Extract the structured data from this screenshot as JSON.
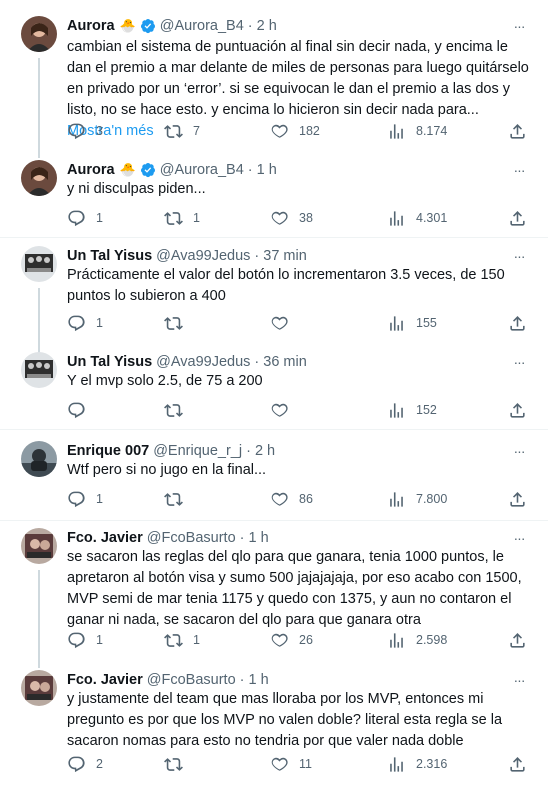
{
  "ui": {
    "more_label": "···",
    "show_more_label": "Mostra'n més"
  },
  "tweets": [
    {
      "name": "Aurora",
      "emoji": "🐣",
      "handle": "@Aurora_B4",
      "time": "2 h",
      "text": "cambian el sistema de puntuación al final sin decir nada, y encima le dan el premio a mar delante de miles de personas para luego quitárselo en privado por un ‘error’. si se equivocan le dan el premio a las dos y listo, no se hace esto. y encima lo hicieron sin decir nada para...",
      "replies": "3",
      "retweets": "7",
      "likes": "182",
      "views": "8.174"
    },
    {
      "name": "Aurora",
      "emoji": "🐣",
      "handle": "@Aurora_B4",
      "time": "1 h",
      "text": "y ni disculpas piden...",
      "replies": "1",
      "retweets": "1",
      "likes": "38",
      "views": "4.301"
    },
    {
      "name": "Un Tal Yisus",
      "handle": "@Ava99Jedus",
      "time": "37 min",
      "text": "Prácticamente el valor del botón lo incrementaron 3.5 veces, de 150 puntos lo subieron a 400",
      "replies": "1",
      "retweets": "",
      "likes": "",
      "views": "155"
    },
    {
      "name": "Un Tal Yisus",
      "handle": "@Ava99Jedus",
      "time": "36 min",
      "text": "Y el mvp solo 2.5, de 75 a 200",
      "replies": "",
      "retweets": "",
      "likes": "",
      "views": "152"
    },
    {
      "name": "Enrique 007",
      "handle": "@Enrique_r_j",
      "time": "2 h",
      "text": "Wtf pero si no jugo en la final...",
      "replies": "1",
      "retweets": "",
      "likes": "86",
      "views": "7.800"
    },
    {
      "name": "Fco. Javier",
      "handle": "@FcoBasurto",
      "time": "1 h",
      "text": "se sacaron las reglas del qlo para que ganara, tenia 1000 puntos, le apretaron al botón visa y sumo 500 jajajajaja, por eso acabo con 1500, MVP semi de mar tenia 1175 y quedo con 1375, y aun no contaron el ganar ni nada, se sacaron del qlo para que ganara otra",
      "replies": "1",
      "retweets": "1",
      "likes": "26",
      "views": "2.598"
    },
    {
      "name": "Fco. Javier",
      "handle": "@FcoBasurto",
      "time": "1 h",
      "text": "y justamente del team que mas lloraba por los MVP, entonces mi pregunto es por que los MVP no valen doble? literal esta regla se la sacaron nomas para esto no tendria por que valer nada doble",
      "replies": "2",
      "retweets": "",
      "likes": "11",
      "views": "2.316"
    }
  ]
}
